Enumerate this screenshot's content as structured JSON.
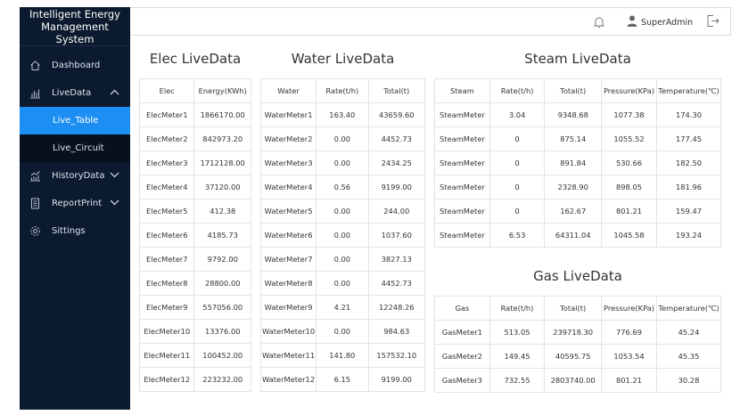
{
  "app": {
    "title_line1": "Intelligent Energy",
    "title_line2": "Management System"
  },
  "sidebar": {
    "items": [
      {
        "label": "Dashboard",
        "icon": "home-icon"
      },
      {
        "label": "LiveData",
        "icon": "bar-chart-icon",
        "expanded": true,
        "children": [
          {
            "label": "Live_Table",
            "active": true
          },
          {
            "label": "Live_Circuit"
          }
        ]
      },
      {
        "label": "HistoryData",
        "icon": "trend-chart-icon",
        "expanded": false
      },
      {
        "label": "ReportPrint",
        "icon": "document-icon",
        "expanded": false
      },
      {
        "label": "Sittings",
        "icon": "gear-icon"
      }
    ]
  },
  "header": {
    "username": "SuperAdmin",
    "icons": [
      "bell-icon",
      "user-icon",
      "logout-icon"
    ]
  },
  "elec": {
    "title": "Elec LiveData",
    "headers": [
      "Elec",
      "Energy(KWh)"
    ],
    "rows": [
      [
        "ElecMeter1",
        "1866170.00"
      ],
      [
        "ElecMeter2",
        "842973.20"
      ],
      [
        "ElecMeter3",
        "1712128.00"
      ],
      [
        "ElecMeter4",
        "37120.00"
      ],
      [
        "ElecMeter5",
        "412.38"
      ],
      [
        "ElecMeter6",
        "4185.73"
      ],
      [
        "ElecMeter7",
        "9792.00"
      ],
      [
        "ElecMeter8",
        "28800.00"
      ],
      [
        "ElecMeter9",
        "557056.00"
      ],
      [
        "ElecMeter10",
        "13376.00"
      ],
      [
        "ElecMeter11",
        "100452.00"
      ],
      [
        "ElecMeter12",
        "223232.00"
      ]
    ]
  },
  "water": {
    "title": "Water LiveData",
    "headers": [
      "Water",
      "Rate(t/h)",
      "Total(t)"
    ],
    "rows": [
      [
        "WaterMeter1",
        "163.40",
        "43659.60"
      ],
      [
        "WaterMeter2",
        "0.00",
        "4452.73"
      ],
      [
        "WaterMeter3",
        "0.00",
        "2434.25"
      ],
      [
        "WaterMeter4",
        "0.56",
        "9199.00"
      ],
      [
        "WaterMeter5",
        "0.00",
        "244.00"
      ],
      [
        "WaterMeter6",
        "0.00",
        "1037.60"
      ],
      [
        "WaterMeter7",
        "0.00",
        "3827.13"
      ],
      [
        "WaterMeter8",
        "0.00",
        "4452.73"
      ],
      [
        "WaterMeter9",
        "4.21",
        "12248.26"
      ],
      [
        "WaterMeter10",
        "0.00",
        "984.63"
      ],
      [
        "WaterMeter11",
        "141.80",
        "157532.10"
      ],
      [
        "WaterMeter12",
        "6.15",
        "9199.00"
      ]
    ]
  },
  "steam": {
    "title": "Steam LiveData",
    "headers": [
      "Steam",
      "Rate(t/h)",
      "Total(t)",
      "Pressure(KPa)",
      "Temperature(℃)"
    ],
    "rows": [
      [
        "SteamMeter",
        "3.04",
        "9348.68",
        "1077.38",
        "174.30"
      ],
      [
        "SteamMeter",
        "0",
        "875.14",
        "1055.52",
        "177.45"
      ],
      [
        "SteamMeter",
        "0",
        "891.84",
        "530.66",
        "182.50"
      ],
      [
        "SteamMeter",
        "0",
        "2328.90",
        "898.05",
        "181.96"
      ],
      [
        "SteamMeter",
        "0",
        "162.67",
        "801.21",
        "159.47"
      ],
      [
        "SteamMeter",
        "6.53",
        "64311.04",
        "1045.58",
        "193.24"
      ]
    ]
  },
  "gas": {
    "title": "Gas LiveData",
    "headers": [
      "Gas",
      "Rate(t/h)",
      "Total(t)",
      "Pressure(KPa)",
      "Temperature(℃)"
    ],
    "rows": [
      [
        "GasMeter1",
        "513.05",
        "239718.30",
        "776.69",
        "45.24"
      ],
      [
        "GasMeter2",
        "149.45",
        "40595.75",
        "1053.54",
        "45.35"
      ],
      [
        "GasMeter3",
        "732.55",
        "2803740.00",
        "801.21",
        "30.28"
      ]
    ]
  },
  "colors": {
    "sidebar_bg": "#0b1a2e",
    "active_item": "#1d8ff2",
    "border": "#e3e3e3"
  }
}
